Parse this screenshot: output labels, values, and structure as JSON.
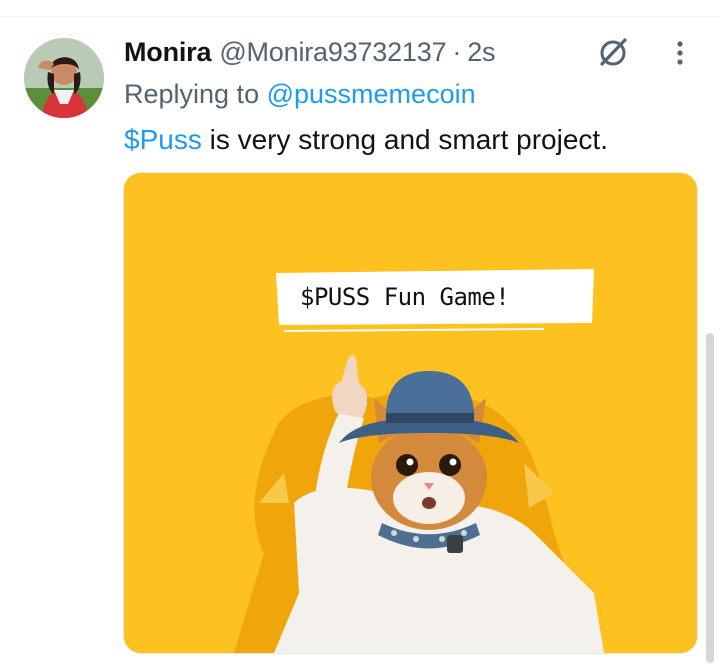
{
  "tweet": {
    "display_name": "Monira",
    "handle": "@Monira93732137",
    "separator": "·",
    "time": "2s",
    "reply_prefix": "Replying to",
    "reply_to": "@pussmemecoin",
    "cashtag": "$Puss",
    "body": " is very strong and smart project."
  },
  "media": {
    "banner_text": "$PUSS Fun Game!",
    "background_color": "#fdc21f"
  },
  "icons": {
    "grok": "grok-icon",
    "more": "more-vertical-icon"
  },
  "colors": {
    "link": "#1d9bf0",
    "muted": "#536471",
    "text": "#0f1419"
  }
}
